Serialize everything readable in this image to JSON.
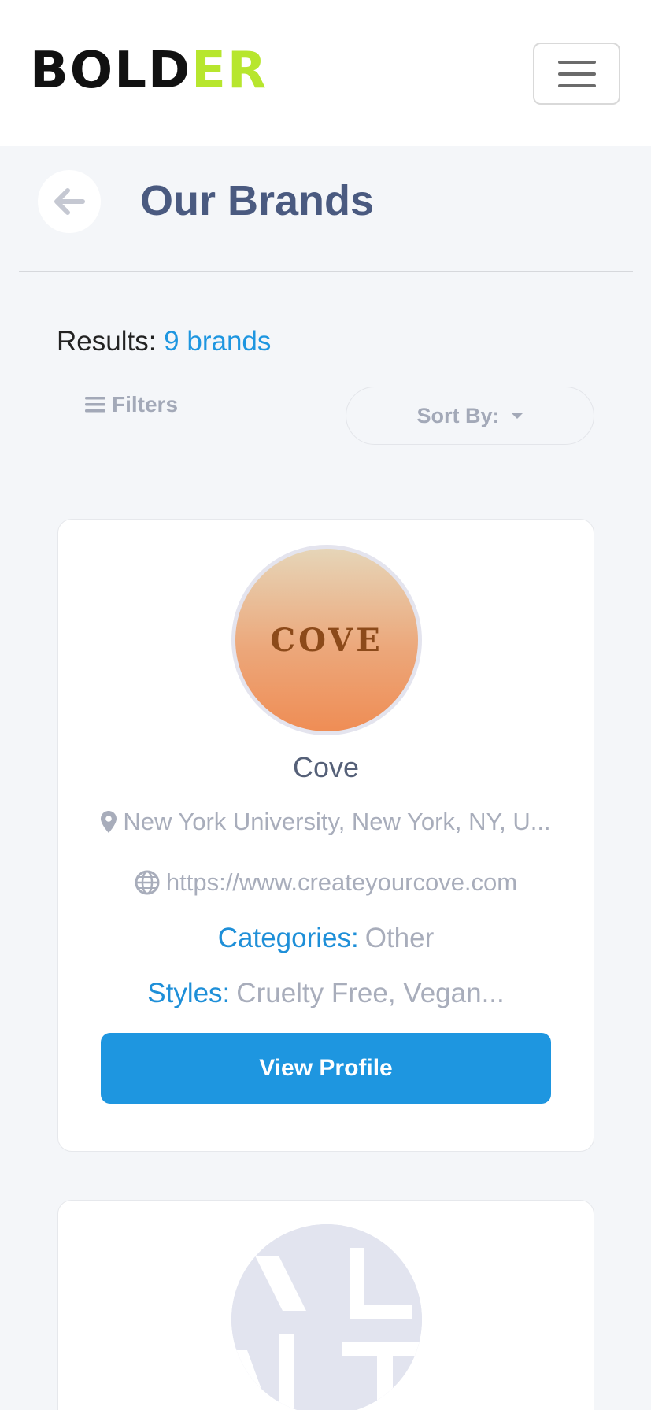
{
  "header": {
    "logo_main": "BOLD",
    "logo_accent_e": "E",
    "logo_accent_r": "R",
    "brand_accent_color": "#b7e62e",
    "menu_icon": "hamburger-menu-icon"
  },
  "page": {
    "back_icon": "arrow-left-icon",
    "title": "Our Brands"
  },
  "results": {
    "label": "Results:",
    "count": "9 brands"
  },
  "toolbar": {
    "filters_label": "Filters",
    "sort_label": "Sort By:"
  },
  "brands": [
    {
      "logo_text": "COVE",
      "name": "Cove",
      "location": "New York University, New York, NY, U...",
      "website": "https://www.createyourcove.com",
      "categories_label": "Categories:",
      "categories": "Other",
      "styles_label": "Styles:",
      "styles": "Cruelty Free, Vegan...",
      "button_label": "View Profile"
    }
  ],
  "colors": {
    "primary": "#1e96e0",
    "title": "#4a5a80",
    "muted": "#a8adbb"
  }
}
